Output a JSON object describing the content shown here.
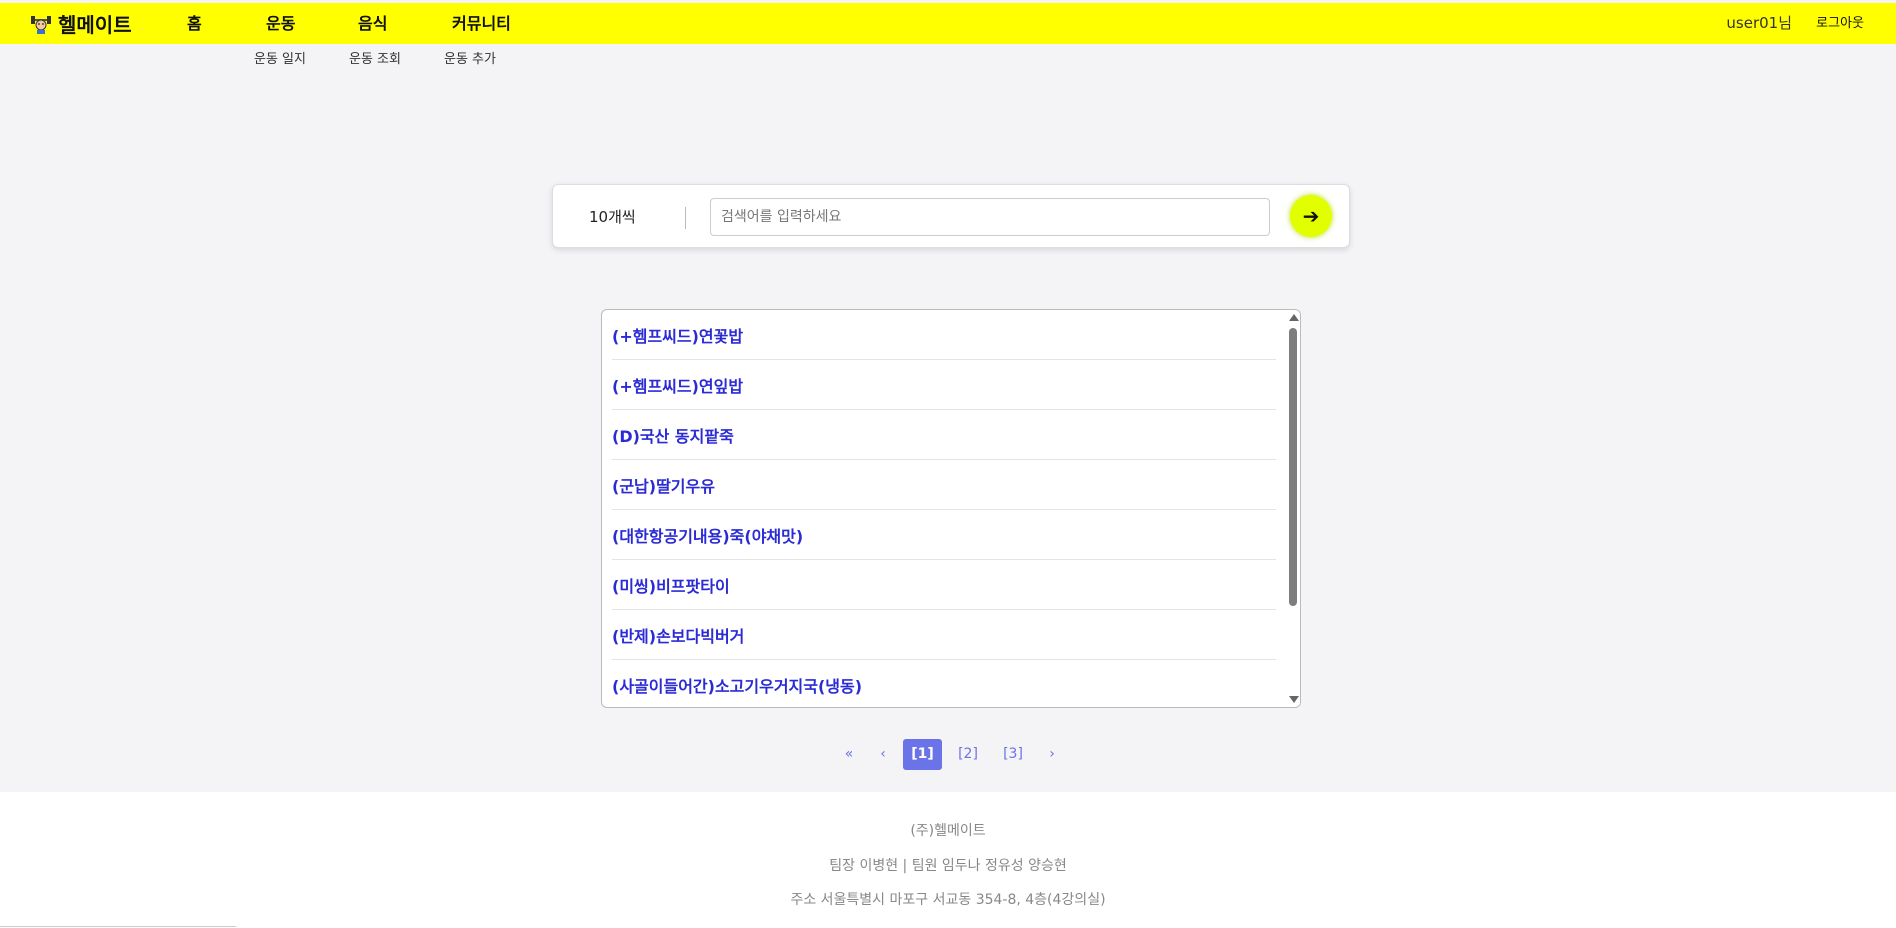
{
  "header": {
    "logo_text": "헬메이트",
    "nav": [
      "홈",
      "운동",
      "음식",
      "커뮤니티"
    ],
    "user": "user01님",
    "logout": "로그아웃"
  },
  "subnav": [
    "운동 일지",
    "운동 조회",
    "운동 추가"
  ],
  "search": {
    "per_page": "10개씩",
    "placeholder": "검색어를 입력하세요",
    "button_icon": "arrow-right-icon",
    "button_symbol": "➔"
  },
  "results": [
    "(+헴프씨드)연꽃밥",
    "(+헴프씨드)연잎밥",
    "(D)국산 동지팥죽",
    "(군납)딸기우유",
    "(대한항공기내용)죽(야채맛)",
    "(미씽)비프팟타이",
    "(반제)손보다빅버거",
    "(사골이들어간)소고기우거지국(냉동)"
  ],
  "pagination": {
    "first": "«",
    "prev": "‹",
    "pages": [
      "[1]",
      "[2]",
      "[3]"
    ],
    "current": 1,
    "next": "›"
  },
  "footer": {
    "company": "(주)헬메이트",
    "team": "팀장 이병현 | 팀원 임두나 정유성 양승현",
    "address": "주소 서울특별시 마포구 서교동 354-8, 4층(4강의실)"
  },
  "colors": {
    "header_bg": "#ffff00",
    "accent": "#e2ff00",
    "link": "#2b2bd6",
    "pager": "#6b73e8"
  }
}
